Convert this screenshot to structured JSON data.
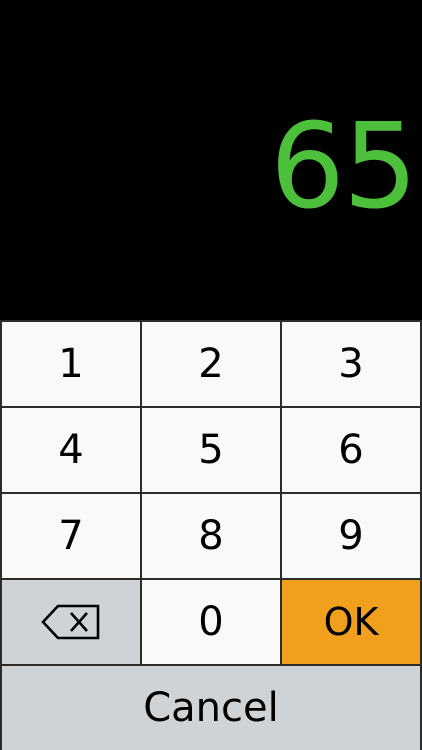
{
  "display": {
    "value": "65",
    "value_color": "#4cc03a"
  },
  "keypad": {
    "keys": {
      "k1": "1",
      "k2": "2",
      "k3": "3",
      "k4": "4",
      "k5": "5",
      "k6": "6",
      "k7": "7",
      "k8": "8",
      "k9": "9",
      "k0": "0"
    },
    "backspace_icon": "backspace-icon",
    "ok_label": "OK",
    "cancel_label": "Cancel",
    "colors": {
      "digit_key_bg": "#f8f9f9",
      "function_key_bg": "#cfd3d6",
      "ok_key_bg": "#f0a01c",
      "separator": "#2b2b2b"
    }
  }
}
